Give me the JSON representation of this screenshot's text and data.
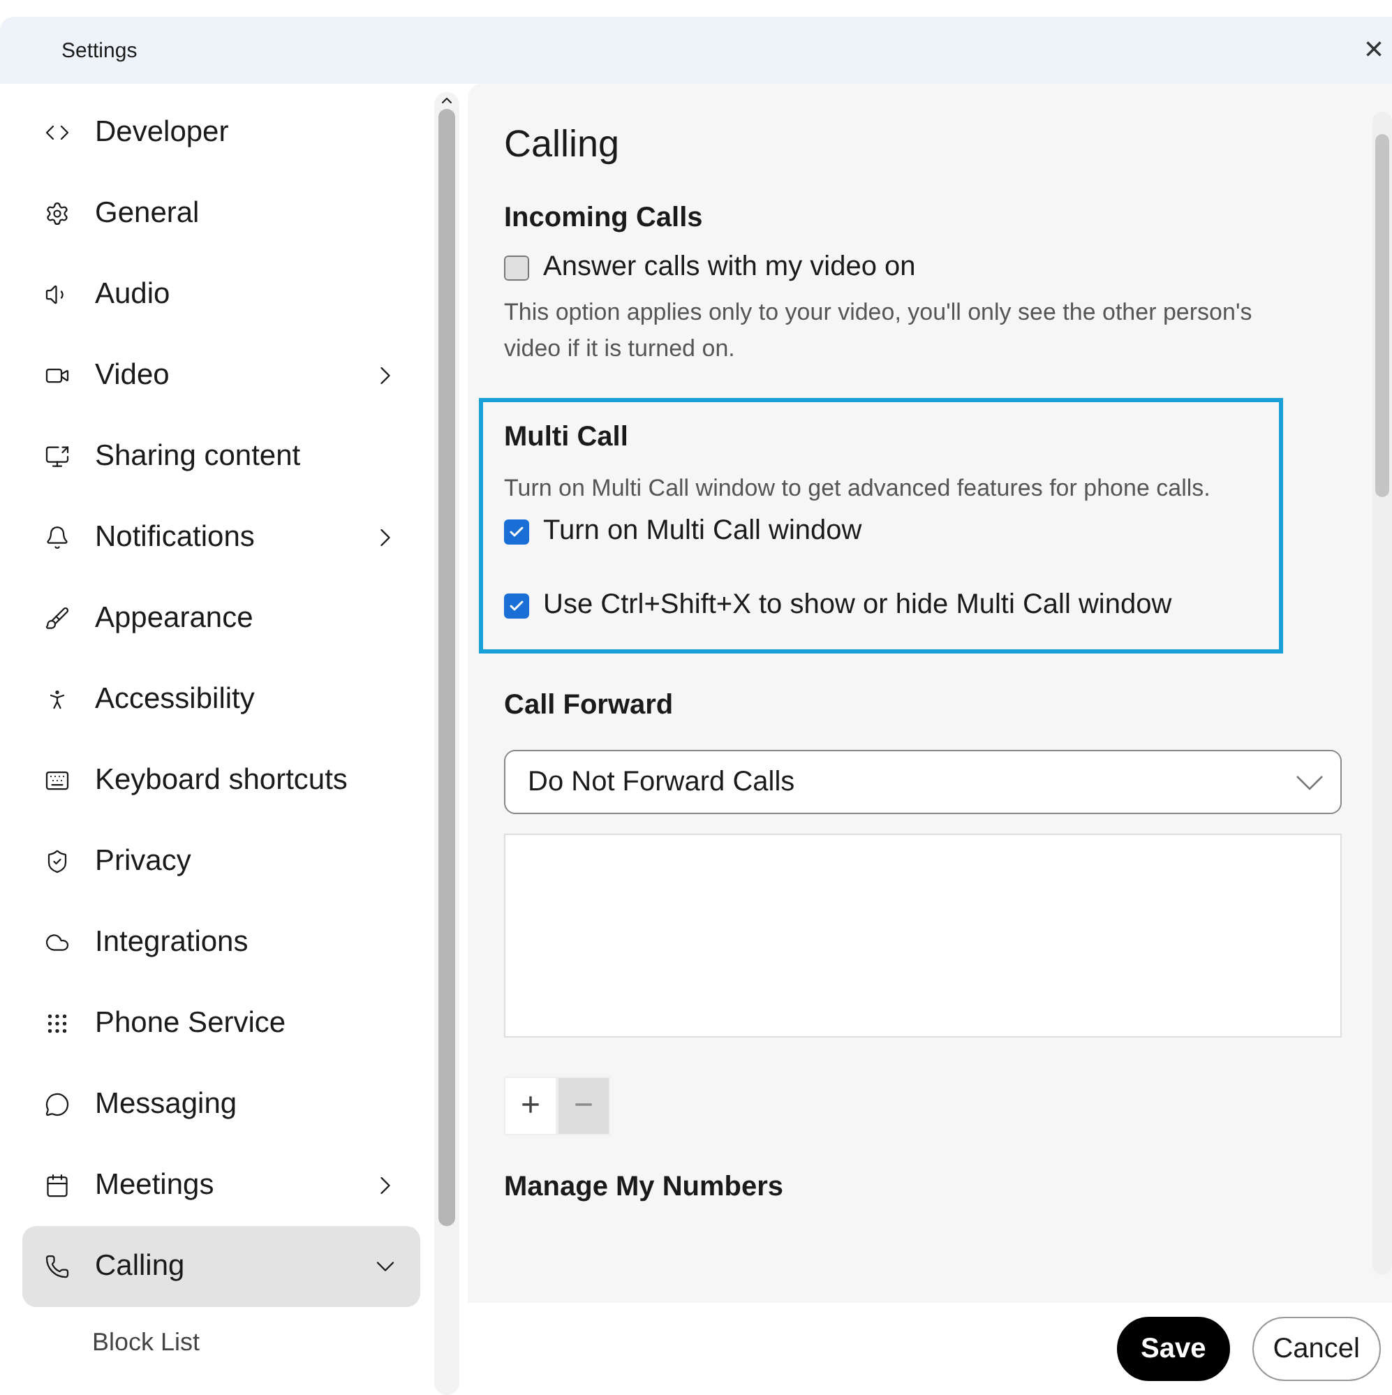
{
  "window": {
    "title": "Settings",
    "close": "×"
  },
  "sidebar": {
    "items": [
      {
        "label": "Developer",
        "selected": false
      },
      {
        "label": "General",
        "selected": false
      },
      {
        "label": "Audio",
        "selected": false
      },
      {
        "label": "Video",
        "selected": false,
        "expanded": false
      },
      {
        "label": "Sharing content",
        "selected": false
      },
      {
        "label": "Notifications",
        "selected": false,
        "expanded": false
      },
      {
        "label": "Appearance",
        "selected": false
      },
      {
        "label": "Accessibility",
        "selected": false
      },
      {
        "label": "Keyboard shortcuts",
        "selected": false
      },
      {
        "label": "Privacy",
        "selected": false
      },
      {
        "label": "Integrations",
        "selected": false
      },
      {
        "label": "Phone Service",
        "selected": false
      },
      {
        "label": "Messaging",
        "selected": false
      },
      {
        "label": "Meetings",
        "selected": false,
        "expanded": false
      },
      {
        "label": "Calling",
        "selected": true,
        "expanded": true,
        "children": [
          {
            "label": "Block List",
            "selected": false
          }
        ]
      }
    ]
  },
  "content": {
    "title": "Calling",
    "incoming_calls": {
      "heading": "Incoming Calls",
      "option": {
        "label": "Answer calls with my video on",
        "checked": false
      },
      "note": "This option applies only to your video, you'll only see the other person's video if it is turned on."
    },
    "multi_call": {
      "heading": "Multi Call",
      "description": "Turn on Multi Call window to get advanced features for phone calls.",
      "options": [
        {
          "label": "Turn on Multi Call window",
          "checked": true
        },
        {
          "label": "Use Ctrl+Shift+X to show or hide Multi Call window",
          "checked": true
        }
      ]
    },
    "call_forward": {
      "heading": "Call Forward",
      "dropdown": "Do Not Forward Calls",
      "add_button": "+",
      "remove_button": {
        "label": "−",
        "disabled": true
      }
    },
    "manage_numbers": {
      "heading": "Manage My Numbers"
    }
  },
  "footer": {
    "buttons": [
      {
        "label": "Save",
        "kind": "primary"
      },
      {
        "label": "Cancel",
        "kind": "secondary"
      }
    ]
  }
}
